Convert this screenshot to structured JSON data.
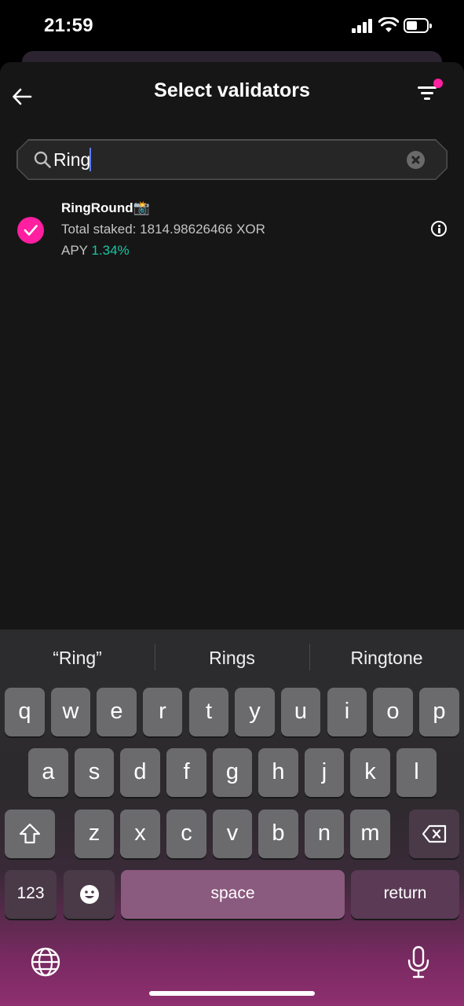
{
  "status": {
    "time": "21:59"
  },
  "header": {
    "title": "Select validators",
    "back_icon": "arrow-left-icon",
    "filter_icon": "filter-icon"
  },
  "search": {
    "value": "Ring",
    "placeholder": ""
  },
  "validators": [
    {
      "name": "RingRound📸",
      "total_staked": "Total staked: 1814.98626466 XOR",
      "apy_label": "APY",
      "apy_value": "1.34%",
      "selected": true
    }
  ],
  "keyboard": {
    "suggestions": [
      "“Ring”",
      "Rings",
      "Ringtone"
    ],
    "row1": [
      "q",
      "w",
      "e",
      "r",
      "t",
      "y",
      "u",
      "i",
      "o",
      "p"
    ],
    "row2": [
      "a",
      "s",
      "d",
      "f",
      "g",
      "h",
      "j",
      "k",
      "l"
    ],
    "row3": [
      "z",
      "x",
      "c",
      "v",
      "b",
      "n",
      "m"
    ],
    "numbers_label": "123",
    "space_label": "space",
    "return_label": "return"
  },
  "colors": {
    "accent": "#ff1fa0",
    "apy": "#1bc5a3",
    "background": "#161616"
  }
}
